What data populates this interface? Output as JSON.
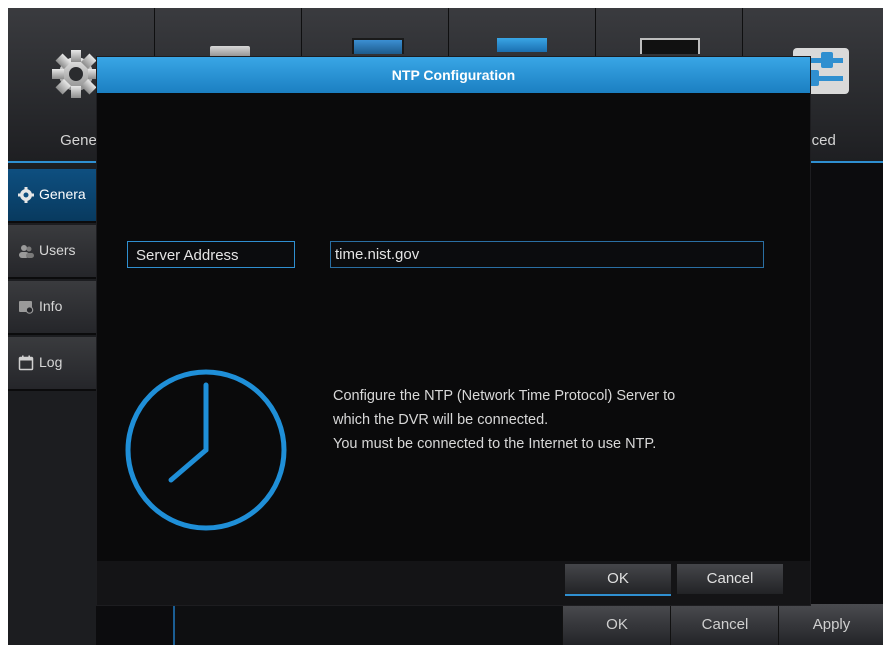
{
  "top_tabs": [
    {
      "label": "Gener",
      "icon": "gear-icon"
    },
    {
      "label": "",
      "icon": "record-icon"
    },
    {
      "label": "",
      "icon": "display-icon"
    },
    {
      "label": "",
      "icon": "network-icon"
    },
    {
      "label": "",
      "icon": "monitor-icon"
    },
    {
      "label": "anced",
      "icon": "sliders-icon"
    }
  ],
  "sidebar": {
    "items": [
      {
        "label": "Genera",
        "icon": "gear-icon",
        "active": true
      },
      {
        "label": "Users",
        "icon": "users-icon",
        "active": false
      },
      {
        "label": "Info",
        "icon": "info-icon",
        "active": false
      },
      {
        "label": "Log",
        "icon": "log-icon",
        "active": false
      }
    ]
  },
  "bottom_bar": {
    "ok_label": "OK",
    "cancel_label": "Cancel",
    "apply_label": "Apply"
  },
  "dialog": {
    "title": "NTP Configuration",
    "server_address_label": "Server Address",
    "server_address_value": "time.nist.gov",
    "description": [
      "Configure the NTP (Network Time Protocol) Server to",
      "which the DVR will be connected.",
      "You must be connected to the Internet to use NTP."
    ],
    "ok_label": "OK",
    "cancel_label": "Cancel",
    "icon": "clock-icon"
  },
  "colors": {
    "accent": "#2f8fd0",
    "header": "#2a94d6",
    "background": "#0a0a0b"
  }
}
